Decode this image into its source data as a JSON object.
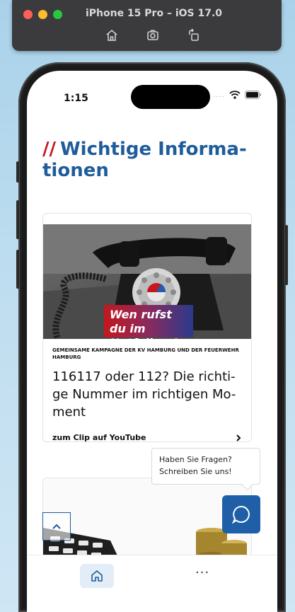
{
  "simulator": {
    "title": "iPhone 15 Pro – iOS 17.0",
    "icons": [
      "home-icon",
      "screenshot-icon",
      "rotate-icon"
    ],
    "traffic_lights": [
      "#ff5f57",
      "#febc2e",
      "#28c840"
    ]
  },
  "status_bar": {
    "time": "1:15",
    "signal": "....",
    "icons": [
      "wifi-icon",
      "battery-icon"
    ]
  },
  "page": {
    "slash": "//",
    "heading": "Wichtige Informa-tionen",
    "colors": {
      "accent_red": "#c4171e",
      "brand_blue": "#1f5c9c"
    }
  },
  "card": {
    "banner": "Wen rufst du im Notfall an?",
    "kicker": "GEMEINSAME KAMPAGNE DER KV HAMBURG UND DER FEUERWEHR HAMBURG",
    "title": "116117 oder 112? Die richti-ge Nummer im richtigen Mo-ment",
    "link": "zum Clip auf YouTube",
    "link_icon": "chevron-right-icon"
  },
  "chat": {
    "tooltip": "Haben Sie Fragen? Schreiben Sie uns!",
    "button_icon": "chat-bubble-icon"
  },
  "scroll_top": {
    "icon": "chevron-up-icon"
  },
  "tabbar": {
    "more": "···",
    "home_icon": "home-icon"
  }
}
